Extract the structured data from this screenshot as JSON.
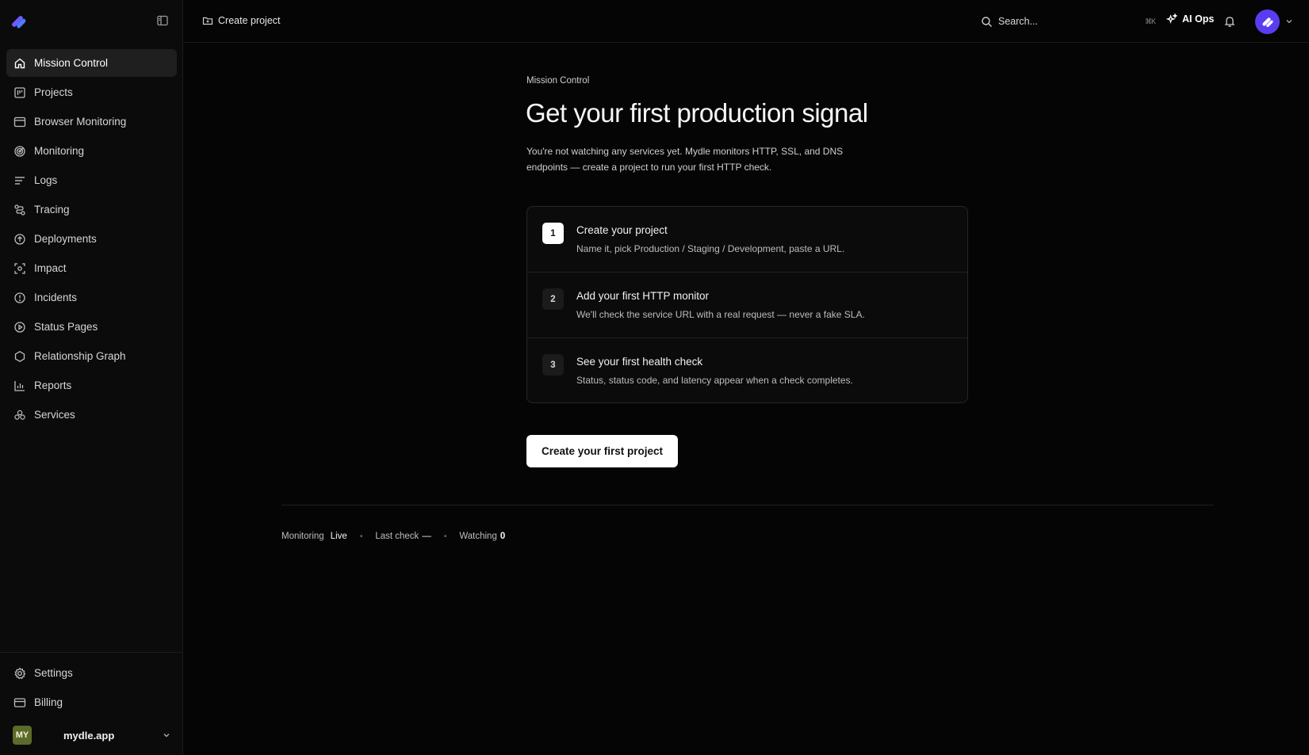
{
  "sidebar": {
    "items": [
      {
        "label": "Mission Control",
        "icon": "home-icon",
        "active": true
      },
      {
        "label": "Projects",
        "icon": "kanban-icon"
      },
      {
        "label": "Browser Monitoring",
        "icon": "browser-window-icon"
      },
      {
        "label": "Monitoring",
        "icon": "radar-icon"
      },
      {
        "label": "Logs",
        "icon": "lines-icon"
      },
      {
        "label": "Tracing",
        "icon": "route-icon"
      },
      {
        "label": "Deployments",
        "icon": "arrow-up-circle-icon"
      },
      {
        "label": "Impact",
        "icon": "focus-scan-icon"
      },
      {
        "label": "Incidents",
        "icon": "alert-circle-icon"
      },
      {
        "label": "Status Pages",
        "icon": "play-circle-icon"
      },
      {
        "label": "Relationship Graph",
        "icon": "hexagon-icon"
      },
      {
        "label": "Reports",
        "icon": "bar-chart-icon"
      },
      {
        "label": "Services",
        "icon": "boxes-icon"
      }
    ],
    "bottom_items": [
      {
        "label": "Settings",
        "icon": "gear-icon"
      },
      {
        "label": "Billing",
        "icon": "credit-card-icon"
      }
    ],
    "workspace": {
      "initials": "MY",
      "name": "mydle.app"
    }
  },
  "topbar": {
    "breadcrumb": "Create project",
    "search_placeholder": "Search...",
    "search_shortcut": "⌘K",
    "ai_ops_label": "AI Ops"
  },
  "main": {
    "eyebrow": "Mission Control",
    "headline": "Get your first production signal",
    "intro": "You're not watching any services yet. Mydle monitors HTTP, SSL, and DNS endpoints — create a project to run your first HTTP check.",
    "steps": [
      {
        "number": "1",
        "title": "Create your project",
        "description": "Name it, pick Production / Staging / Development, paste a URL."
      },
      {
        "number": "2",
        "title": "Add your first HTTP monitor",
        "description": "We'll check the service URL with a real request — never a fake SLA."
      },
      {
        "number": "3",
        "title": "See your first health check",
        "description": "Status, status code, and latency appear when a check completes."
      }
    ],
    "cta_label": "Create your first project",
    "status": {
      "monitoring_label": "Monitoring",
      "monitoring_value": "Live",
      "last_check_label": "Last check",
      "last_check_value": "—",
      "watching_label": "Watching",
      "watching_value": "0"
    }
  },
  "colors": {
    "background": "#050505",
    "sidebar": "#0b0b0b",
    "accent": "#5a3df0",
    "workspace_badge": "#5b6b2a"
  }
}
